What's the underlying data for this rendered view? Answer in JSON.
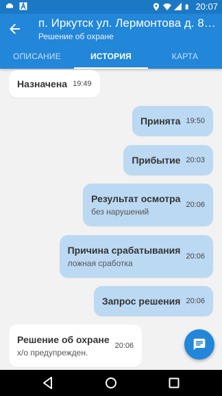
{
  "status_bar": {
    "time": "20:07",
    "icons": [
      "taxi-icon",
      "a-icon",
      "location-icon",
      "wifi-icon",
      "signal-icon",
      "battery-icon"
    ]
  },
  "app_bar": {
    "title": "п. Иркутск ул. Лермонтова д. 81...",
    "subtitle": "Решение об охране"
  },
  "tabs": [
    {
      "label": "ОПИСАНИЕ",
      "active": false
    },
    {
      "label": "ИСТОРИЯ",
      "active": true
    },
    {
      "label": "КАРТА",
      "active": false
    }
  ],
  "messages": [
    {
      "side": "in",
      "title": "Назначена",
      "time": "19:49"
    },
    {
      "side": "out",
      "title": "Принята",
      "time": "19:50"
    },
    {
      "side": "out",
      "title": "Прибытие",
      "time": "20:03"
    },
    {
      "side": "out",
      "title": "Результат осмотра",
      "subtitle": "без нарушений",
      "time": "20:06"
    },
    {
      "side": "out",
      "title": "Причина срабатывания",
      "subtitle": "ложная сработка",
      "time": "20:06"
    },
    {
      "side": "out",
      "title": "Запрос решения",
      "time": "20:06"
    },
    {
      "side": "in",
      "title": "Решение об охране",
      "subtitle": "х/о предупрежден.",
      "time": "20:06"
    }
  ],
  "colors": {
    "primary": "#2286d9",
    "status_bar": "#1b78c4",
    "outgoing_bubble": "#bcd9f3",
    "incoming_bubble": "#ffffff",
    "background": "#f2f2f2"
  }
}
